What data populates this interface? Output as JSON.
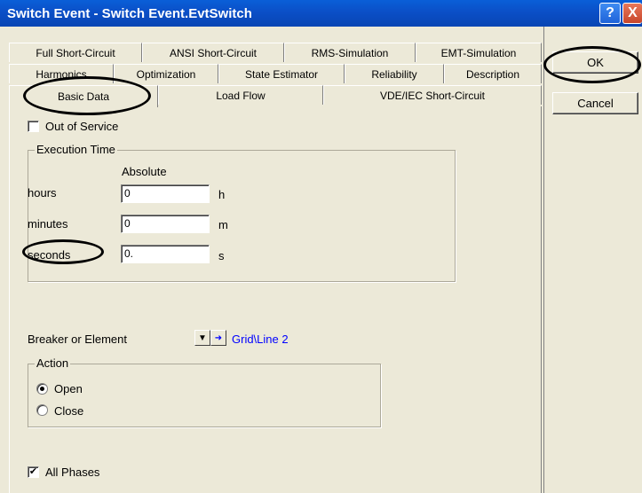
{
  "window": {
    "title": "Switch Event - Switch Event.EvtSwitch",
    "help_glyph": "?",
    "close_glyph": "X"
  },
  "tabs": {
    "row1": [
      "Full Short-Circuit",
      "ANSI Short-Circuit",
      "RMS-Simulation",
      "EMT-Simulation"
    ],
    "row2": [
      "Harmonics",
      "Optimization",
      "State Estimator",
      "Reliability",
      "Description"
    ],
    "row3": [
      "Basic Data",
      "Load Flow",
      "VDE/IEC Short-Circuit"
    ],
    "active": "Basic Data"
  },
  "buttons": {
    "ok": "OK",
    "cancel": "Cancel"
  },
  "out_of_service": {
    "label": "Out of Service",
    "checked": false
  },
  "execution_time": {
    "title": "Execution Time",
    "column_header": "Absolute",
    "rows": [
      {
        "label": "hours",
        "value": "0",
        "unit": "h"
      },
      {
        "label": "minutes",
        "value": "0",
        "unit": "m"
      },
      {
        "label": "seconds",
        "value": "0.",
        "unit": "s"
      }
    ]
  },
  "breaker": {
    "label": "Breaker or Element",
    "value": "Grid\\Line 2",
    "link_color": "#0000ff"
  },
  "action": {
    "title": "Action",
    "options": [
      "Open",
      "Close"
    ],
    "selected": "Open"
  },
  "all_phases": {
    "label": "All Phases",
    "checked": true
  }
}
